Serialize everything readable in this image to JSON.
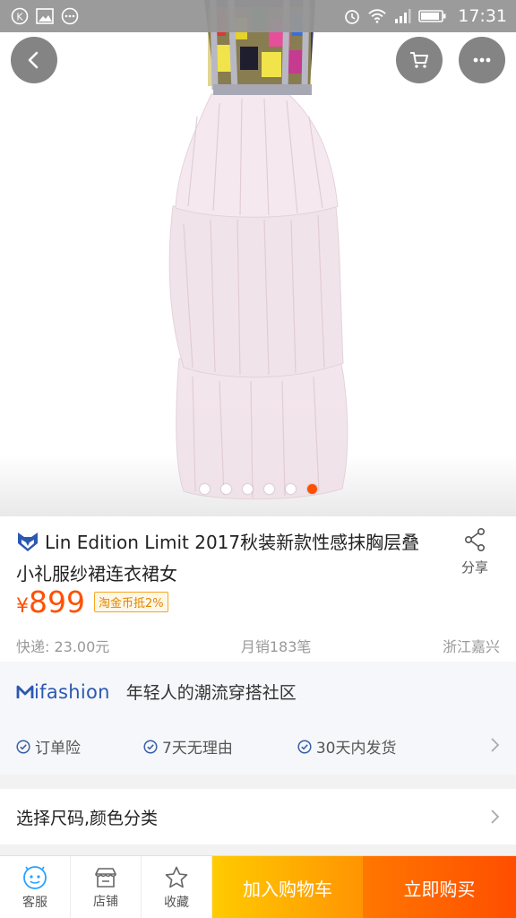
{
  "status_bar": {
    "time": "17:31",
    "left_icons": [
      "k-badge-icon",
      "image-icon",
      "more-dots-icon"
    ],
    "right_icons": [
      "alarm-icon",
      "wifi-icon",
      "signal-icon",
      "battery-icon"
    ]
  },
  "hero": {
    "image_alt": "strapless sequin tiered tulle dress",
    "dot_count": 6,
    "active_dot": 5
  },
  "product": {
    "title": "Lin Edition Limit 2017秋装新款性感抹胸层叠小礼服纱裙连衣裙女",
    "share_label": "分享",
    "currency": "¥",
    "price": "899",
    "coupon": "淘金币抵2%",
    "shipping": "快递: 23.00元",
    "monthly_sales": "月销183笔",
    "location": "浙江嘉兴"
  },
  "ifashion": {
    "logo_text": "ifashion",
    "slogan": "年轻人的潮流穿搭社区"
  },
  "services": [
    {
      "label": "订单险"
    },
    {
      "label": "7天无理由"
    },
    {
      "label": "30天内发货"
    }
  ],
  "sku": {
    "label": "选择尺码,颜色分类"
  },
  "bottom_bar": {
    "service_label": "客服",
    "shop_label": "店铺",
    "favorite_label": "收藏",
    "add_cart_label": "加入购物车",
    "buy_now_label": "立即购买"
  },
  "colors": {
    "accent_orange": "#ff5000",
    "cart_yellow": "#ffb400",
    "ifashion_blue": "#2c58b0"
  }
}
